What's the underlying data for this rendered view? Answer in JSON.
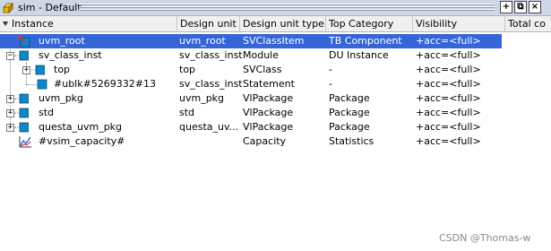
{
  "window": {
    "title": "sim - Default",
    "buttons": [
      "+",
      "⧉",
      "×"
    ]
  },
  "columns": [
    "Instance",
    "Design unit",
    "Design unit type",
    "Top Category",
    "Visibility",
    "Total co"
  ],
  "rows": [
    {
      "instance": "uvm_root",
      "design_unit": "uvm_root",
      "unit_type": "SVClassItem",
      "category": "TB Component",
      "visibility": "+acc=<full>",
      "icon": "class-item-icon",
      "expander": "",
      "selected": true
    },
    {
      "instance": "sv_class_inst",
      "design_unit": "sv_class_inst",
      "unit_type": "Module",
      "category": "DU Instance",
      "visibility": "+acc=<full>",
      "icon": "module-icon",
      "expander": "−",
      "selected": false
    },
    {
      "instance": "top",
      "design_unit": "top",
      "unit_type": "SVClass",
      "category": "-",
      "visibility": "+acc=<full>",
      "icon": "module-icon",
      "expander": "+",
      "selected": false
    },
    {
      "instance": "#ublk#5269332#13",
      "design_unit": "sv_class_inst",
      "unit_type": "Statement",
      "category": "-",
      "visibility": "+acc=<full>",
      "icon": "module-icon",
      "expander": "",
      "selected": false
    },
    {
      "instance": "uvm_pkg",
      "design_unit": "uvm_pkg",
      "unit_type": "VlPackage",
      "category": "Package",
      "visibility": "+acc=<full>",
      "icon": "module-icon",
      "expander": "+",
      "selected": false
    },
    {
      "instance": "std",
      "design_unit": "std",
      "unit_type": "VlPackage",
      "category": "Package",
      "visibility": "+acc=<full>",
      "icon": "module-icon",
      "expander": "+",
      "selected": false
    },
    {
      "instance": "questa_uvm_pkg",
      "design_unit": "questa_uv...",
      "unit_type": "VlPackage",
      "category": "Package",
      "visibility": "+acc=<full>",
      "icon": "module-icon",
      "expander": "+",
      "selected": false
    },
    {
      "instance": "#vsim_capacity#",
      "design_unit": "",
      "unit_type": "Capacity",
      "category": "Statistics",
      "visibility": "+acc=<full>",
      "icon": "capacity-chart-icon",
      "expander": "",
      "selected": false
    }
  ],
  "watermark": "CSDN @Thomas-w",
  "colors": {
    "selection": "#3565d6",
    "module_icon": "#0e86c8"
  }
}
